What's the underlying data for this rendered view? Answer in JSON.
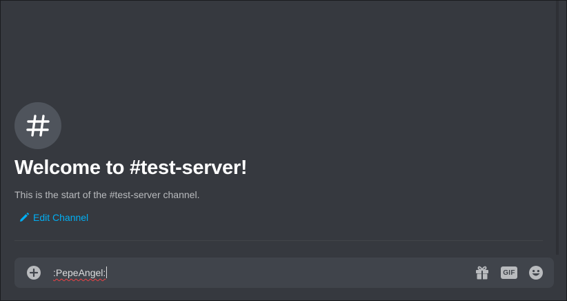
{
  "channel": {
    "icon": "hash-icon",
    "welcome_title": "Welcome to #test-server!",
    "welcome_subtitle": "This is the start of the #test-server channel.",
    "edit_label": "Edit Channel"
  },
  "composer": {
    "typed_text": ":PepeAngel:",
    "add_icon": "plus-circle-icon",
    "tools": [
      "gift-icon",
      "gif-icon",
      "emoji-icon"
    ],
    "gif_label": "GIF"
  },
  "colors": {
    "background": "#36393f",
    "link": "#00aff4",
    "composer": "#40444b",
    "spellcheck": "#ed4245"
  }
}
